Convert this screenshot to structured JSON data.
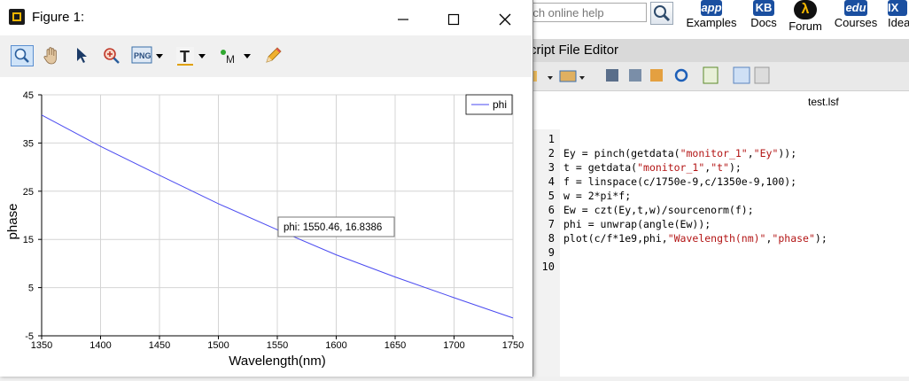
{
  "background_app": {
    "search_placeholder": "rch online help",
    "nav": [
      {
        "label": "Examples",
        "icon": "app-icon",
        "icon_text": "app"
      },
      {
        "label": "Docs",
        "icon": "kb-icon",
        "icon_text": "KB"
      },
      {
        "label": "Forum",
        "icon": "forum-icon",
        "icon_text": "λ"
      },
      {
        "label": "Courses",
        "icon": "edu-icon",
        "icon_text": "edu"
      },
      {
        "label": "Idea",
        "icon": "idea-icon",
        "icon_text": "IX"
      }
    ],
    "editor": {
      "title": "cript File Editor",
      "tab_label": "test.lsf",
      "line_numbers": [
        "1",
        "2",
        "3",
        "4",
        "5",
        "6",
        "7",
        "8",
        "9",
        "10"
      ],
      "code_lines": [
        "",
        "Ey = pinch(getdata(\"monitor_1\",\"Ey\"));",
        "t = getdata(\"monitor_1\",\"t\");",
        "f = linspace(c/1750e-9,c/1350e-9,100);",
        "w = 2*pi*f;",
        "Ew = czt(Ey,t,w)/sourcenorm(f);",
        "phi = unwrap(angle(Ew));",
        "plot(c/f*1e9,phi,\"Wavelength(nm)\",\"phase\");",
        "",
        ""
      ]
    }
  },
  "figure_window": {
    "title": "Figure 1:",
    "controls": {
      "minimize": "—",
      "maximize": "☐",
      "close": "✕"
    },
    "toolbar_icons": [
      "zoom-icon",
      "pan-hand-icon",
      "select-arrow-icon",
      "zoom-region-icon",
      "png-export-icon",
      "text-tool-icon",
      "marker-tool-icon",
      "pencil-icon"
    ],
    "png_label": "PNG"
  },
  "chart_data": {
    "type": "line",
    "title": "",
    "xlabel": "Wavelength(nm)",
    "ylabel": "phase",
    "xlim": [
      1350,
      1750
    ],
    "ylim": [
      -5,
      45
    ],
    "x_ticks": [
      "1350",
      "1400",
      "1450",
      "1500",
      "1550",
      "1600",
      "1650",
      "1700",
      "1750"
    ],
    "y_ticks": [
      "45",
      "35",
      "25",
      "15",
      "5",
      "-5"
    ],
    "y_tick_values": [
      45,
      35,
      25,
      15,
      5,
      -5
    ],
    "grid": true,
    "legend_position": "top-right",
    "series": [
      {
        "name": "phi",
        "color": "#4a4af0",
        "x": [
          1350,
          1400,
          1450,
          1500,
          1550,
          1600,
          1650,
          1700,
          1750
        ],
        "y": [
          40.8,
          34.3,
          28.3,
          22.4,
          17.0,
          11.8,
          7.2,
          2.9,
          -1.3
        ]
      }
    ],
    "datatip": "phi: 1550.46, 16.8386"
  }
}
